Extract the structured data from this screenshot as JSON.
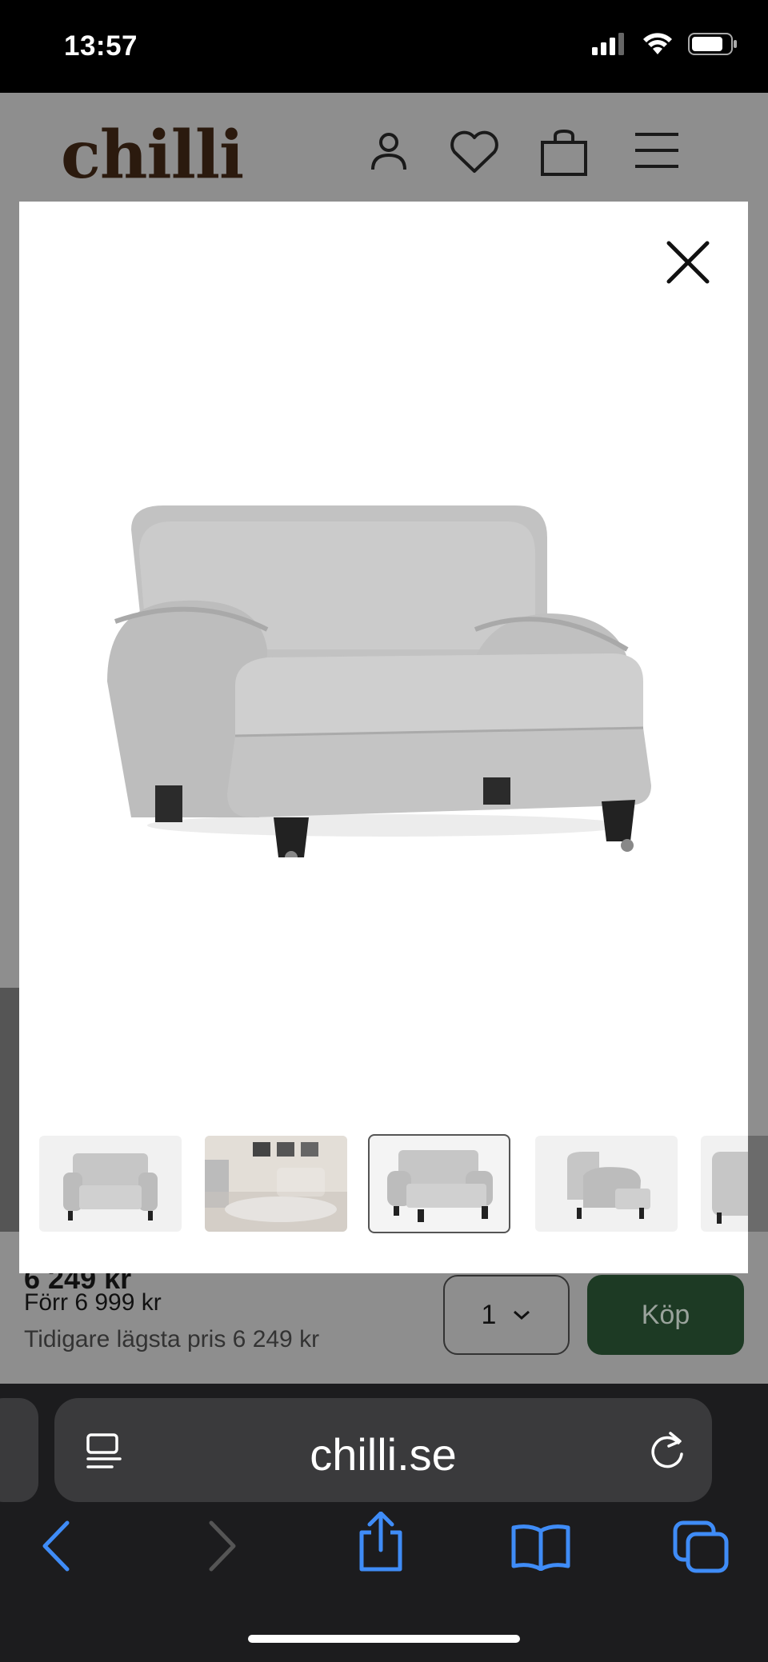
{
  "status_bar": {
    "time": "13:57"
  },
  "header": {
    "logo": "chilli"
  },
  "product": {
    "price_now": "6 249 kr",
    "price_before": "Förr 6 999 kr",
    "price_lowest": "Tidigare lägsta pris 6 249 kr",
    "quantity": "1",
    "buy_label": "Köp"
  },
  "gallery": {
    "main_image_icon": "armchair-image",
    "thumbnails": [
      {
        "icon": "armchair-front-thumbnail",
        "active": false
      },
      {
        "icon": "living-room-thumbnail",
        "active": false
      },
      {
        "icon": "armchair-angle-thumbnail",
        "active": true
      },
      {
        "icon": "armchair-side-thumbnail",
        "active": false
      },
      {
        "icon": "armchair-partial-thumbnail",
        "active": false
      }
    ]
  },
  "browser": {
    "url": "chilli.se"
  },
  "colors": {
    "overlay": "#8e8e8e",
    "logo": "#2b1a0e",
    "buy_button": "#1d3a24",
    "browser_chrome": "#1c1c1e",
    "link_blue": "#3f8cf7"
  }
}
